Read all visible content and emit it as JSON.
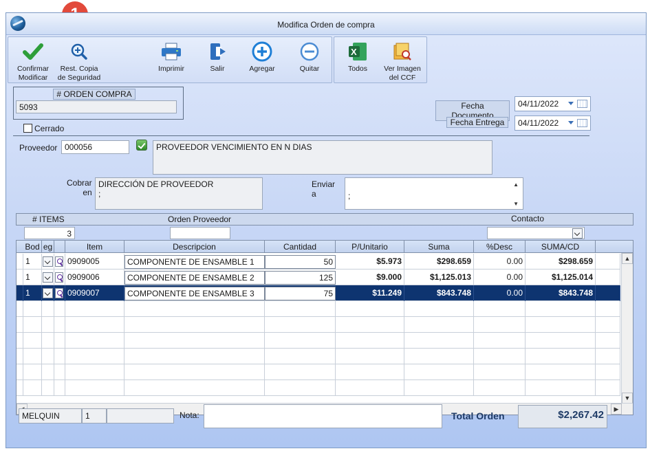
{
  "window": {
    "title": "Modifica Orden de compra"
  },
  "callout": {
    "number": "1"
  },
  "toolbar": {
    "confirm_label": "Confirmar\nModificar",
    "restore_label": "Rest. Copia\nde Seguridad",
    "print_label": "Imprimir",
    "exit_label": "Salir",
    "add_label": "Agregar",
    "remove_label": "Quitar",
    "all_label": "Todos",
    "view_image_label": "Ver Imagen\ndel CCF"
  },
  "order": {
    "number_label": "# ORDEN COMPRA",
    "number": "5093",
    "closed_label": "Cerrado",
    "doc_date_label": "Fecha Documento",
    "doc_date": "04/11/2022",
    "delivery_date_label": "Fecha Entrega",
    "delivery_date": "04/11/2022"
  },
  "supplier": {
    "label": "Proveedor",
    "code": "000056",
    "name": "PROVEEDOR VENCIMIENTO EN N DIAS",
    "bill_label": "Cobrar\nen",
    "bill_address_line1": "DIRECCIÓN DE PROVEEDOR",
    "bill_address_line2": ";",
    "send_label": "Enviar\na",
    "send_address": ";"
  },
  "summary": {
    "items_label": "# ITEMS",
    "items_count": "3",
    "supplier_order_label": "Orden Proveedor",
    "supplier_order": "",
    "contact_label": "Contacto",
    "contact": ""
  },
  "grid": {
    "headers": [
      "Bod",
      "eg",
      "",
      "Item",
      "Descripcion",
      "Cantidad",
      "P/Unitario",
      "Suma",
      "%Desc",
      "SUMA/CD"
    ],
    "rows": [
      {
        "bod": "1",
        "item": "0909005",
        "description": "COMPONENTE DE ENSAMBLE 1",
        "quantity": "50",
        "unit_price": "$5.973",
        "sum": "$298.659",
        "discount": "0.00",
        "sum_cd": "$298.659"
      },
      {
        "bod": "1",
        "item": "0909006",
        "description": "COMPONENTE DE ENSAMBLE 2",
        "quantity": "125",
        "unit_price": "$9.000",
        "sum": "$1,125.013",
        "discount": "0.00",
        "sum_cd": "$1,125.014"
      },
      {
        "bod": "1",
        "item": "0909007",
        "description": "COMPONENTE DE ENSAMBLE 3",
        "quantity": "75",
        "unit_price": "$11.249",
        "sum": "$843.748",
        "discount": "0.00",
        "sum_cd": "$843.748"
      }
    ],
    "selected_row": 2
  },
  "footer": {
    "user": "MELQUIN",
    "session": "1",
    "status": "",
    "note_label": "Nota:",
    "note": "",
    "total_label": "Total Orden",
    "total": "$2,267.42"
  },
  "colors": {
    "accent": "#0e3470",
    "badge": "#e24a3b",
    "confirm_check": "#2e9e3a"
  }
}
